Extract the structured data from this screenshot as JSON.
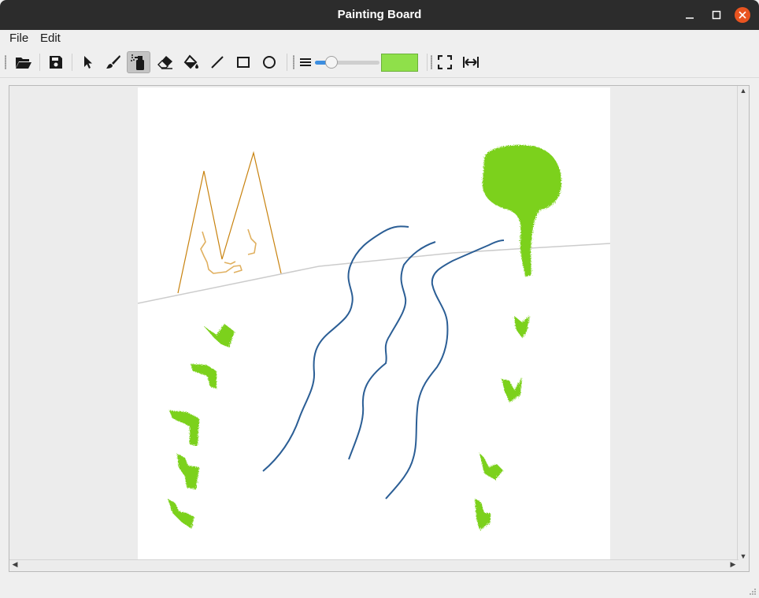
{
  "window": {
    "title": "Painting Board"
  },
  "menu": {
    "file": "File",
    "edit": "Edit"
  },
  "toolbar": {
    "tools": [
      "open-folder-icon",
      "save-icon",
      "pointer-icon",
      "brush-icon",
      "spray-icon",
      "eraser-icon",
      "fill-bucket-icon",
      "line-icon",
      "rectangle-icon",
      "ellipse-icon",
      "pen-width-icon",
      "fullscreen-icon",
      "fit-width-icon"
    ],
    "active_tool": "spray",
    "pen_size_fraction": 0.2,
    "current_color": "#8fe04a"
  },
  "colors": {
    "title_bar": "#2c2c2c",
    "close_button": "#e95420",
    "slider_accent": "#3c8ee0",
    "mountain_stroke": "#c8820e",
    "cave_stroke": "#e0b060",
    "horizon_stroke": "#cccccc",
    "river_stroke": "#2b5e95",
    "tree_fill": "#7bd11e"
  }
}
